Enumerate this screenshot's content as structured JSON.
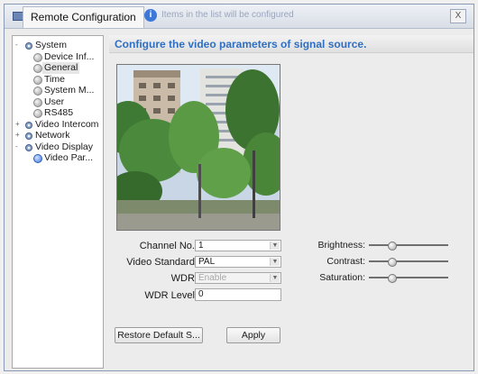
{
  "window": {
    "tab_title": "Remote Configuration",
    "hint_text": "Items in the list will be configured",
    "close_label": "X"
  },
  "sidebar": {
    "items": [
      {
        "label": "System",
        "level": 0,
        "expander": "-",
        "icon": "gear-icon"
      },
      {
        "label": "Device Inf...",
        "level": 1,
        "icon": "dot-icon"
      },
      {
        "label": "General",
        "level": 1,
        "icon": "dot-icon",
        "selected": true
      },
      {
        "label": "Time",
        "level": 1,
        "icon": "dot-icon"
      },
      {
        "label": "System M...",
        "level": 1,
        "icon": "dot-icon"
      },
      {
        "label": "User",
        "level": 1,
        "icon": "dot-icon"
      },
      {
        "label": "RS485",
        "level": 1,
        "icon": "dot-icon"
      },
      {
        "label": "Video Intercom",
        "level": 0,
        "expander": "+",
        "icon": "gear-icon"
      },
      {
        "label": "Network",
        "level": 0,
        "expander": "+",
        "icon": "gear-icon"
      },
      {
        "label": "Video Display",
        "level": 0,
        "expander": "-",
        "icon": "gear-icon"
      },
      {
        "label": "Video Par...",
        "level": 1,
        "icon": "dot-icon",
        "active": true
      }
    ]
  },
  "main": {
    "title": "Configure the video parameters of signal source.",
    "channel_label": "Channel No.:",
    "channel_value": "1",
    "standard_label": "Video Standard:",
    "standard_value": "PAL",
    "wdr_label": "WDR:",
    "wdr_value": "Enable",
    "wdr_level_label": "WDR Level:",
    "wdr_level_value": "0",
    "brightness_label": "Brightness:",
    "contrast_label": "Contrast:",
    "saturation_label": "Saturation:",
    "brightness_level": 0.3,
    "contrast_level": 0.3,
    "saturation_level": 0.3,
    "restore_label": "Restore Default S...",
    "apply_label": "Apply"
  },
  "colors": {
    "title_blue": "#2f6fc2",
    "window_border": "#8a9bb5"
  }
}
